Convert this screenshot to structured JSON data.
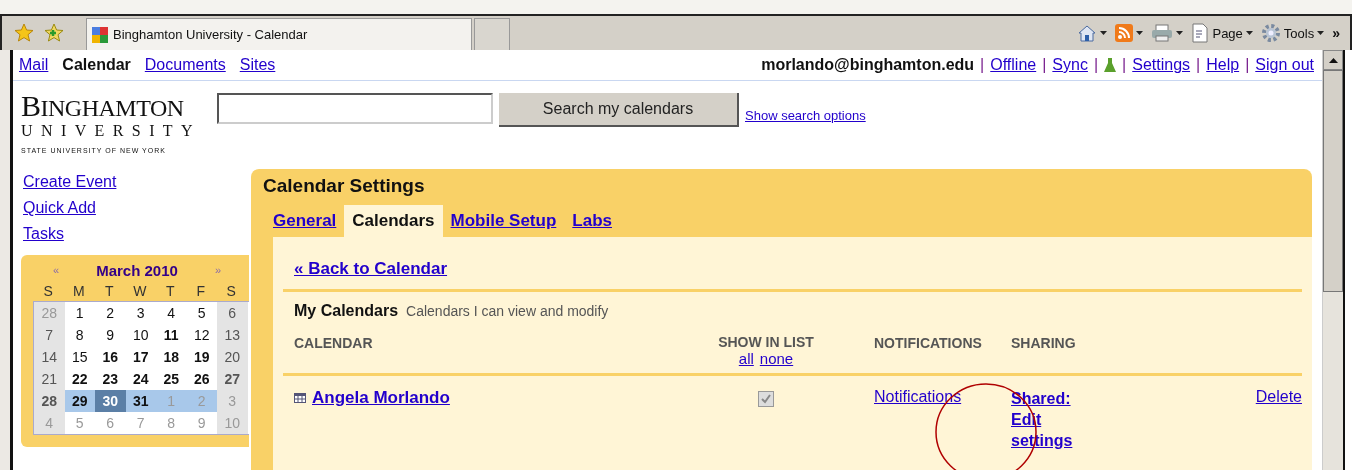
{
  "browser": {
    "tab_title": "Binghamton University - Calendar",
    "commands": [
      {
        "kind": "home"
      },
      {
        "kind": "feeds"
      },
      {
        "kind": "print"
      },
      {
        "kind": "page",
        "label": "Page"
      },
      {
        "kind": "tools",
        "label": "Tools"
      }
    ],
    "overflow": "»"
  },
  "apps": [
    {
      "label": "Mail",
      "selected": false
    },
    {
      "label": "Calendar",
      "selected": true
    },
    {
      "label": "Documents",
      "selected": false
    },
    {
      "label": "Sites",
      "selected": false
    }
  ],
  "account": {
    "user": "morlando@binghamton.edu",
    "separator": "|",
    "links": [
      {
        "kind": "link",
        "label": "Offline"
      },
      {
        "kind": "link",
        "label": "Sync"
      },
      {
        "kind": "labs"
      },
      {
        "kind": "link",
        "label": "Settings"
      },
      {
        "kind": "link",
        "label": "Help"
      },
      {
        "kind": "link",
        "label": "Sign out"
      }
    ]
  },
  "logo": {
    "name": "BINGHAMTON",
    "subtitle": "UNIVERSITY",
    "tagline": "STATE UNIVERSITY OF NEW YORK"
  },
  "search": {
    "button": "Search my calendars",
    "options_link": "Show search options"
  },
  "sidebar": {
    "links": [
      "Create Event",
      "Quick Add",
      "Tasks"
    ]
  },
  "mini_calendar": {
    "prev": "«",
    "title": "March 2010",
    "next": "»",
    "weekdays": [
      "S",
      "M",
      "T",
      "W",
      "T",
      "F",
      "S"
    ],
    "weeks": [
      {
        "selected": false,
        "days": [
          {
            "label": "28",
            "muted": true,
            "bold": false,
            "today": false
          },
          {
            "label": "1",
            "muted": false,
            "bold": false,
            "today": false
          },
          {
            "label": "2",
            "muted": false,
            "bold": false,
            "today": false
          },
          {
            "label": "3",
            "muted": false,
            "bold": false,
            "today": false
          },
          {
            "label": "4",
            "muted": false,
            "bold": false,
            "today": false
          },
          {
            "label": "5",
            "muted": false,
            "bold": false,
            "today": false
          },
          {
            "label": "6",
            "muted": false,
            "bold": false,
            "today": false
          }
        ]
      },
      {
        "selected": false,
        "days": [
          {
            "label": "7",
            "muted": false,
            "bold": false,
            "today": false
          },
          {
            "label": "8",
            "muted": false,
            "bold": false,
            "today": false
          },
          {
            "label": "9",
            "muted": false,
            "bold": false,
            "today": false
          },
          {
            "label": "10",
            "muted": false,
            "bold": false,
            "today": false
          },
          {
            "label": "11",
            "muted": false,
            "bold": true,
            "today": false
          },
          {
            "label": "12",
            "muted": false,
            "bold": false,
            "today": false
          },
          {
            "label": "13",
            "muted": false,
            "bold": false,
            "today": false
          }
        ]
      },
      {
        "selected": false,
        "days": [
          {
            "label": "14",
            "muted": false,
            "bold": false,
            "today": false
          },
          {
            "label": "15",
            "muted": false,
            "bold": false,
            "today": false
          },
          {
            "label": "16",
            "muted": false,
            "bold": true,
            "today": false
          },
          {
            "label": "17",
            "muted": false,
            "bold": true,
            "today": false
          },
          {
            "label": "18",
            "muted": false,
            "bold": true,
            "today": false
          },
          {
            "label": "19",
            "muted": false,
            "bold": true,
            "today": false
          },
          {
            "label": "20",
            "muted": false,
            "bold": false,
            "today": false
          }
        ]
      },
      {
        "selected": false,
        "days": [
          {
            "label": "21",
            "muted": false,
            "bold": false,
            "today": false
          },
          {
            "label": "22",
            "muted": false,
            "bold": true,
            "today": false
          },
          {
            "label": "23",
            "muted": false,
            "bold": true,
            "today": false
          },
          {
            "label": "24",
            "muted": false,
            "bold": true,
            "today": false
          },
          {
            "label": "25",
            "muted": false,
            "bold": true,
            "today": false
          },
          {
            "label": "26",
            "muted": false,
            "bold": true,
            "today": false
          },
          {
            "label": "27",
            "muted": false,
            "bold": true,
            "today": false
          }
        ]
      },
      {
        "selected": true,
        "days": [
          {
            "label": "28",
            "muted": false,
            "bold": true,
            "today": false
          },
          {
            "label": "29",
            "muted": false,
            "bold": true,
            "today": false
          },
          {
            "label": "30",
            "muted": false,
            "bold": true,
            "today": true
          },
          {
            "label": "31",
            "muted": false,
            "bold": true,
            "today": false
          },
          {
            "label": "1",
            "muted": true,
            "bold": false,
            "today": false
          },
          {
            "label": "2",
            "muted": true,
            "bold": false,
            "today": false
          },
          {
            "label": "3",
            "muted": true,
            "bold": false,
            "today": false
          }
        ]
      },
      {
        "selected": false,
        "days": [
          {
            "label": "4",
            "muted": true,
            "bold": false,
            "today": false
          },
          {
            "label": "5",
            "muted": true,
            "bold": false,
            "today": false
          },
          {
            "label": "6",
            "muted": true,
            "bold": false,
            "today": false
          },
          {
            "label": "7",
            "muted": true,
            "bold": false,
            "today": false
          },
          {
            "label": "8",
            "muted": true,
            "bold": false,
            "today": false
          },
          {
            "label": "9",
            "muted": true,
            "bold": false,
            "today": false
          },
          {
            "label": "10",
            "muted": true,
            "bold": false,
            "today": false
          }
        ]
      }
    ]
  },
  "settings": {
    "title": "Calendar Settings",
    "tabs": [
      {
        "label": "General",
        "selected": false
      },
      {
        "label": "Calendars",
        "selected": true
      },
      {
        "label": "Mobile Setup",
        "selected": false
      },
      {
        "label": "Labs",
        "selected": false
      }
    ],
    "back_link": "« Back to Calendar",
    "section": {
      "title": "My Calendars",
      "subtitle": "Calendars I can view and modify"
    },
    "columns": [
      "CALENDAR",
      "SHOW IN LIST",
      "NOTIFICATIONS",
      "SHARING"
    ],
    "show_links": [
      "all",
      "none"
    ],
    "rows": [
      {
        "name": "Angela Morlando",
        "checked": true,
        "disabled": true,
        "notifications": "Notifications",
        "sharing": "Shared: Edit settings",
        "delete": "Delete"
      }
    ]
  }
}
